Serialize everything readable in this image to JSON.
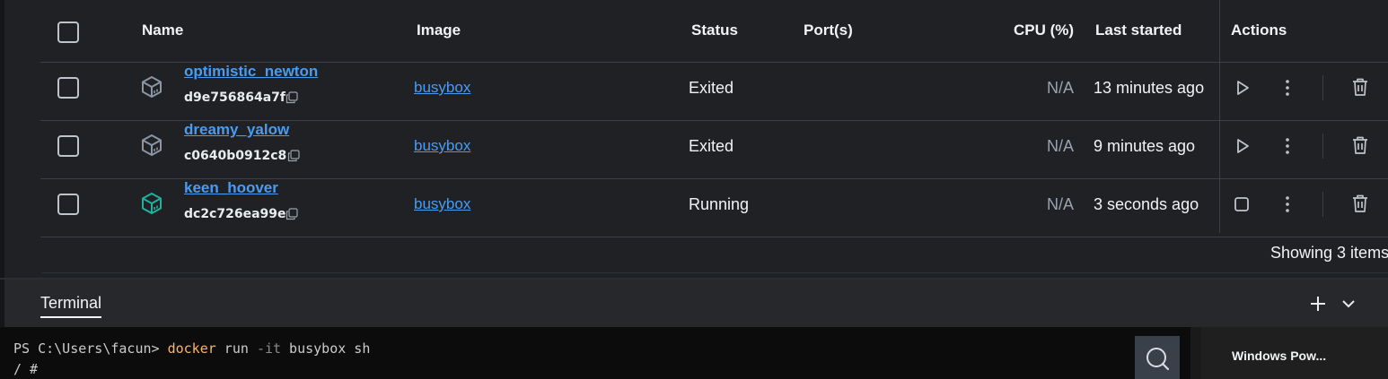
{
  "table": {
    "headers": {
      "name": "Name",
      "image": "Image",
      "status": "Status",
      "ports": "Port(s)",
      "cpu": "CPU (%)",
      "last_started": "Last started",
      "actions": "Actions"
    },
    "rows": [
      {
        "name": "optimistic_newton",
        "id": "d9e756864a7f",
        "image": "busybox",
        "status": "Exited",
        "ports": "",
        "cpu": "N/A",
        "last_started": "13 minutes ago",
        "running": false,
        "icon": "container-icon"
      },
      {
        "name": "dreamy_yalow",
        "id": "c0640b0912c8",
        "image": "busybox",
        "status": "Exited",
        "ports": "",
        "cpu": "N/A",
        "last_started": "9 minutes ago",
        "running": false,
        "icon": "container-icon"
      },
      {
        "name": "keen_hoover",
        "id": "dc2c726ea99e",
        "image": "busybox",
        "status": "Running",
        "ports": "",
        "cpu": "N/A",
        "last_started": "3 seconds ago",
        "running": true,
        "icon": "container-running-icon"
      }
    ],
    "footer": "Showing 3 items"
  },
  "terminal": {
    "tab_label": "Terminal",
    "prompt": "PS C:\\Users\\facun> ",
    "command": "docker",
    "args_before_flag": " run ",
    "flag": "-it",
    "args_after_flag": " busybox sh",
    "line2": "/ #",
    "session_label": "Windows Pow..."
  },
  "colors": {
    "link": "#4a9cf0",
    "running_icon": "#1fb39e",
    "stopped_icon": "#8a96a3",
    "background": "#202124",
    "terminal_bg": "#0c0c0c"
  }
}
